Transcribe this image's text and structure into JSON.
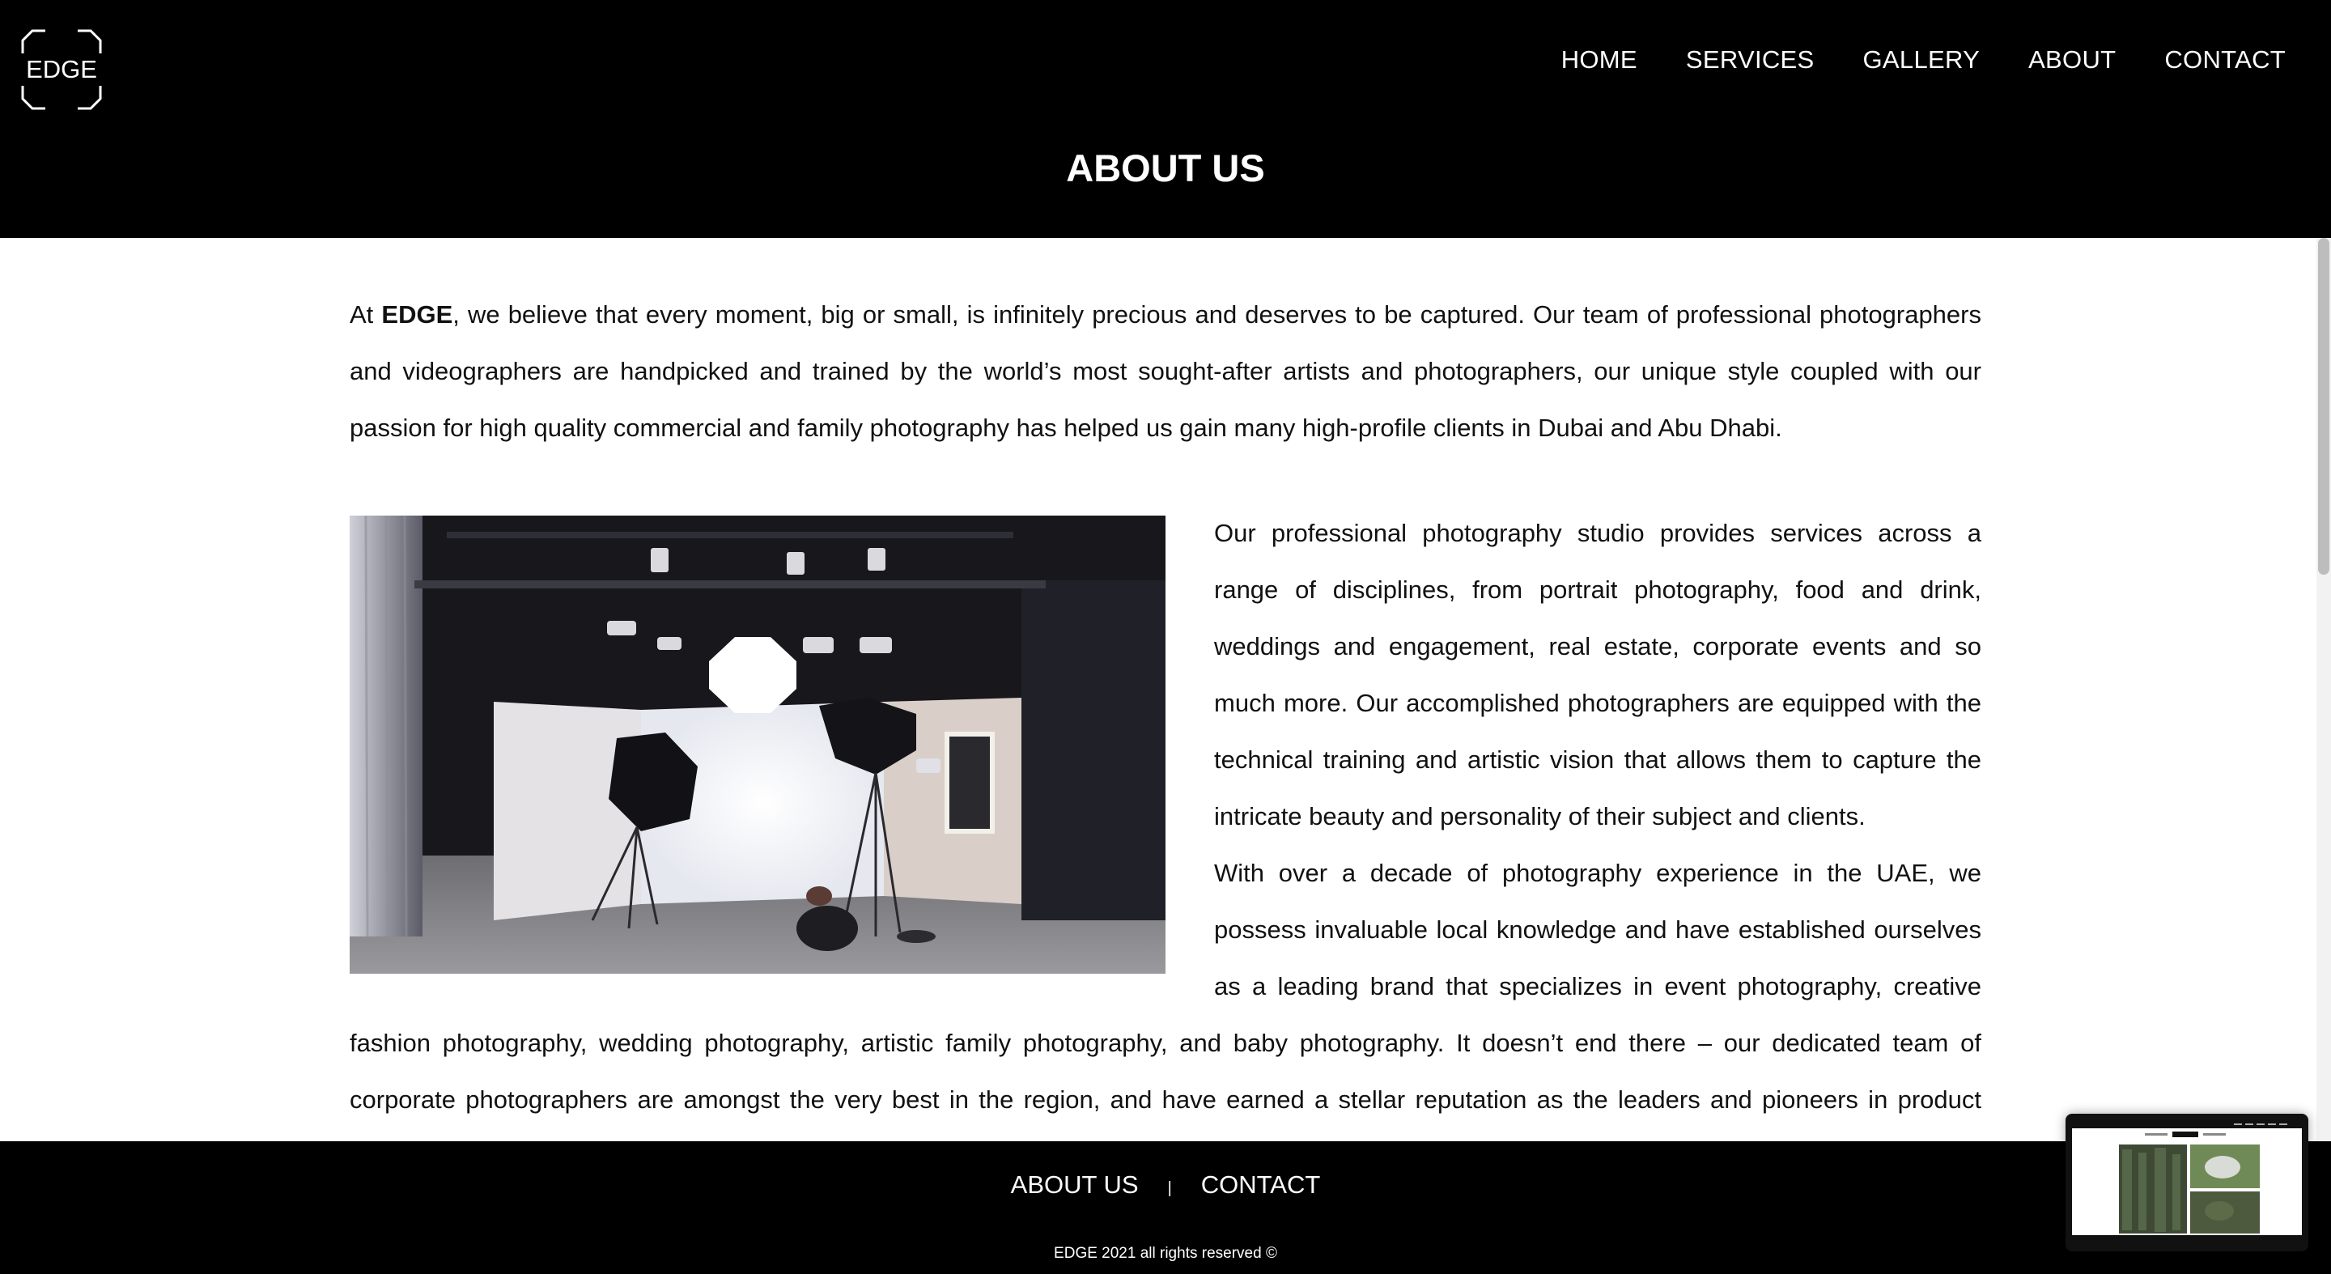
{
  "brand": {
    "logo_text": "EDGE"
  },
  "nav": {
    "items": [
      {
        "label": "HOME"
      },
      {
        "label": "SERVICES"
      },
      {
        "label": "GALLERY"
      },
      {
        "label": "ABOUT"
      },
      {
        "label": "CONTACT"
      }
    ]
  },
  "page": {
    "title": "ABOUT US"
  },
  "content": {
    "intro_prefix": "At ",
    "intro_brand": "EDGE",
    "intro_rest": ", we believe that every moment, big or small, is infinitely precious and deserves to be captured. Our team of professional photographers and videographers are handpicked and trained by the world’s most sought-after artists and photographers, our unique style coupled with our passion for high quality commercial and family photography has helped us gain many high-profile clients in Dubai and Abu Dhabi.",
    "paragraph_1": "Our professional photography studio provides services across a range of disciplines, from portrait photography, food and drink, weddings and engagement, real estate, corporate events and so much more. Our accomplished photographers are equipped with the technical training and artistic vision that allows them to capture the intricate beauty and personality of their subject and clients.",
    "paragraph_2": "With over a decade of photography experience in the UAE, we possess invaluable local knowledge and have established ourselves as a leading brand that specializes in event photography, creative fashion photography, wedding photography, artistic family photography, and baby photography. It doesn’t end there – our dedicated team of corporate photographers are amongst the very best in the region, and have earned a stellar reputation as the leaders and pioneers in product photography, mouth-watering food photography,"
  },
  "footer": {
    "links": [
      {
        "label": "ABOUT US"
      },
      {
        "label": "CONTACT"
      }
    ],
    "separator": "|",
    "copyright": "EDGE 2021 all rights reserved ©"
  },
  "colors": {
    "header_bg": "#000000",
    "footer_bg": "#000000",
    "text": "#111111",
    "inverse_text": "#ffffff"
  }
}
